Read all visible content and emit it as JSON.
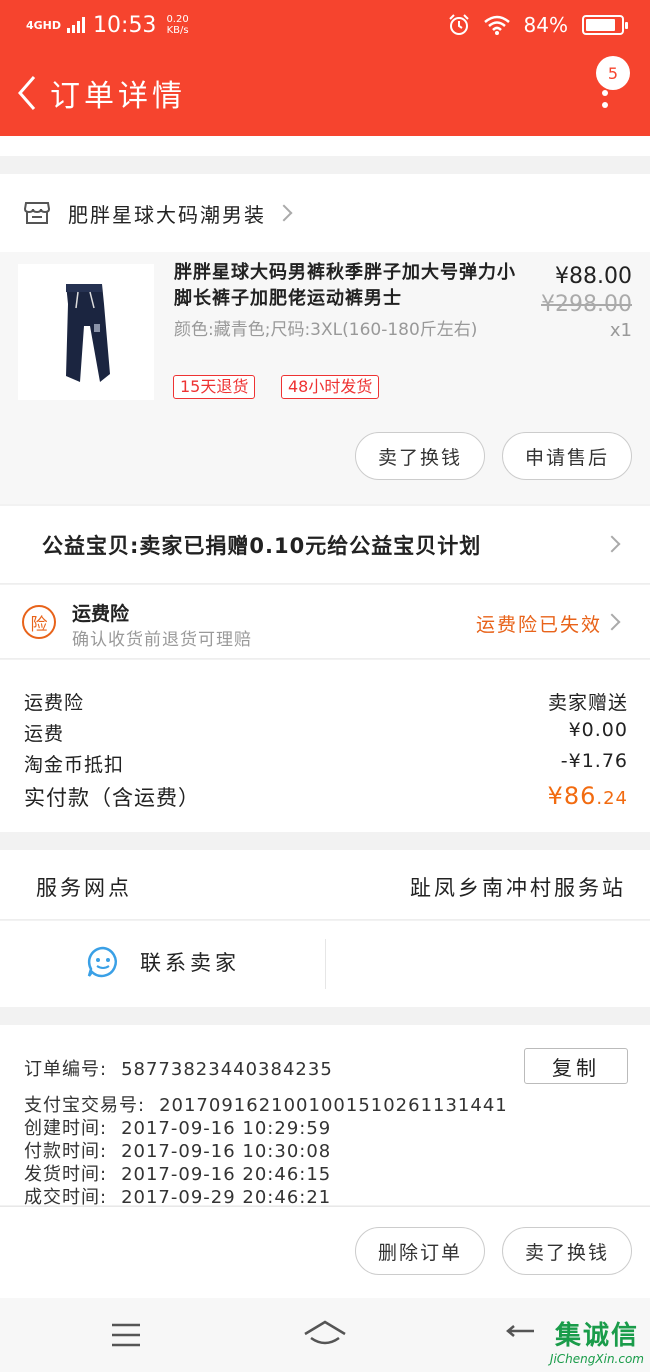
{
  "status_bar": {
    "network": "4GHD",
    "time": "10:53",
    "speed_value": "0.20",
    "speed_unit": "KB/s",
    "battery": "84%",
    "battery_level": 0.84
  },
  "nav": {
    "title": "订单详情",
    "badge": "5"
  },
  "shop": {
    "name": "肥胖星球大码潮男装"
  },
  "item": {
    "name": "胖胖星球大码男裤秋季胖子加大号弹力小脚长裤子加肥佬运动裤男士",
    "spec": "颜色:藏青色;尺码:3XL(160-180斤左右)",
    "price": "¥88.00",
    "original_price": "¥298.00",
    "qty": "x1",
    "tags": [
      "15天退货",
      "48小时发货"
    ],
    "buttons": [
      "卖了换钱",
      "申请售后"
    ]
  },
  "charity": {
    "text": "公益宝贝:卖家已捐赠0.10元给公益宝贝计划"
  },
  "insurance": {
    "icon_text": "险",
    "title": "运费险",
    "subtitle": "确认收货前退货可理赔",
    "status": "运费险已失效"
  },
  "costs": {
    "rows": [
      {
        "label": "运费险",
        "value": "卖家赠送"
      },
      {
        "label": "运费",
        "value": "¥0.00"
      },
      {
        "label": "淘金币抵扣",
        "value": "-¥1.76"
      }
    ],
    "total_label": "实付款（含运费）",
    "total_currency": "¥",
    "total_int": "86",
    "total_dec": ".24"
  },
  "service": {
    "label": "服务网点",
    "value": "趾凤乡南冲村服务站"
  },
  "contact": {
    "label": "联系卖家"
  },
  "order_info": {
    "order_no_label": "订单编号:",
    "order_no": "58773823440384235",
    "copy_label": "复制",
    "alipay_label": "支付宝交易号:",
    "alipay_no": "2017091621001001510261131441",
    "created_label": "创建时间:",
    "created": "2017-09-16 10:29:59",
    "paid_label": "付款时间:",
    "paid": "2017-09-16 10:30:08",
    "shipped_label": "发货时间:",
    "shipped": "2017-09-16 20:46:15",
    "done_label": "成交时间:",
    "done": "2017-09-29 20:46:21"
  },
  "footer": {
    "delete_label": "删除订单",
    "sell_label": "卖了换钱"
  },
  "watermark": {
    "cn": "集诚信",
    "en": "JiChengXin.com"
  },
  "colors": {
    "brand": "#f6442e",
    "price_orange": "#f26b10",
    "tag_red": "#e33333",
    "insurance_orange": "#e8631a",
    "contact_blue": "#3aa0e6"
  }
}
